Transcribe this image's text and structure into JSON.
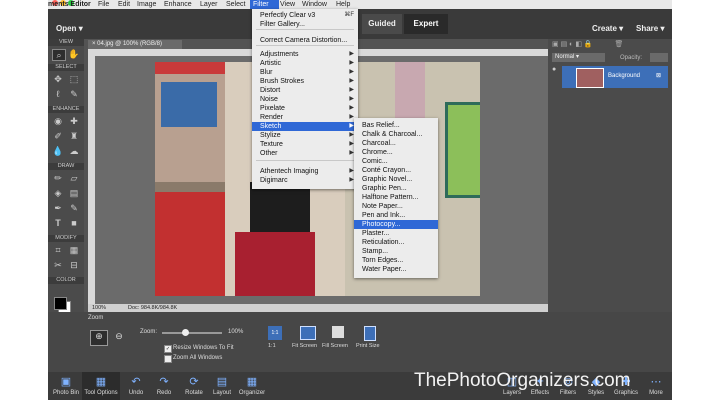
{
  "menubar": {
    "app_name": "ments Editor",
    "items": [
      "File",
      "Edit",
      "Image",
      "Enhance",
      "Layer",
      "Select",
      "Filter",
      "View",
      "Window",
      "Help"
    ]
  },
  "topbar": {
    "open": "Open",
    "modes": [
      "Guided",
      "Expert"
    ],
    "create": "Create",
    "share": "Share"
  },
  "toolbox": {
    "sections": [
      "VIEW",
      "SELECT",
      "ENHANCE",
      "DRAW",
      "MODIFY",
      "COLOR"
    ],
    "icons": [
      "zoom-icon",
      "hand-icon",
      "move-icon",
      "marquee-icon",
      "lasso-icon",
      "quick-selection-icon",
      "eye-icon",
      "spot-healing-icon",
      "brush-smart-fix-icon",
      "clone-stamp-icon",
      "blur-icon",
      "sponge-icon",
      "brush-icon",
      "eraser-icon",
      "paint-bucket-icon",
      "gradient-icon",
      "eyedropper-icon",
      "pencil-icon",
      "text-icon",
      "shape-icon",
      "crop-icon",
      "recompose-icon",
      "content-aware-move-icon",
      "straighten-icon"
    ]
  },
  "document": {
    "tab_title": "04.jpg @ 100% (RGB/8)",
    "zoom_readout": "100%",
    "doc_size": "Doc: 984.8K/984.8K"
  },
  "options": {
    "zoom_label": "Zoom",
    "zoom_slider_label": "Zoom:",
    "zoom_value": "100%",
    "resize_windows": "Resize Windows To Fit",
    "zoom_all": "Zoom All Windows",
    "one_to_one": "1:1",
    "fit_screen": "Fit Screen",
    "fill_screen": "Fill Screen",
    "print_size": "Print Size"
  },
  "taskbar": {
    "left": [
      "Photo Bin",
      "Tool Options",
      "Undo",
      "Redo",
      "Rotate",
      "Layout",
      "Organizer"
    ],
    "right": [
      "Layers",
      "Effects",
      "Filters",
      "Styles",
      "Graphics",
      "More"
    ]
  },
  "layers": {
    "blend_mode": "Normal",
    "opacity_label": "Opacity:",
    "layer_name": "Background"
  },
  "filter_menu": {
    "items": [
      {
        "label": "Perfectly Clear v3",
        "shortcut": "⌘F"
      },
      {
        "label": "Filter Gallery..."
      },
      {
        "label": "Correct Camera Distortion..."
      },
      {
        "label": "Adjustments",
        "sub": true
      },
      {
        "label": "Artistic",
        "sub": true
      },
      {
        "label": "Blur",
        "sub": true
      },
      {
        "label": "Brush Strokes",
        "sub": true
      },
      {
        "label": "Distort",
        "sub": true
      },
      {
        "label": "Noise",
        "sub": true
      },
      {
        "label": "Pixelate",
        "sub": true
      },
      {
        "label": "Render",
        "sub": true
      },
      {
        "label": "Sketch",
        "sub": true,
        "highlighted": true
      },
      {
        "label": "Stylize",
        "sub": true
      },
      {
        "label": "Texture",
        "sub": true
      },
      {
        "label": "Other",
        "sub": true
      },
      {
        "label": "Athentech Imaging",
        "sub": true
      },
      {
        "label": "Digimarc",
        "sub": true
      }
    ]
  },
  "sketch_menu": {
    "items": [
      "Bas Relief...",
      "Chalk & Charcoal...",
      "Charcoal...",
      "Chrome...",
      "Comic...",
      "Conté Crayon...",
      "Graphic Novel...",
      "Graphic Pen...",
      "Halftone Pattern...",
      "Note Paper...",
      "Pen and Ink...",
      "Photocopy...",
      "Plaster...",
      "Reticulation...",
      "Stamp...",
      "Torn Edges...",
      "Water Paper..."
    ],
    "highlighted_index": 11
  },
  "watermark": "ThePhotoOrganizers.com",
  "colors": {
    "highlight": "#2f68d6",
    "menu_bg": "#ececec",
    "ui_dark": "#535353"
  }
}
